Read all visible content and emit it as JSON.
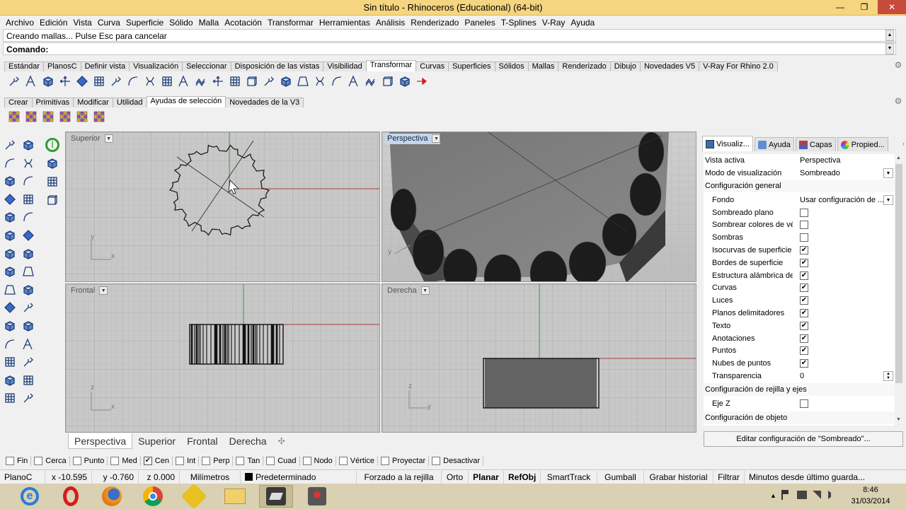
{
  "window": {
    "title": "Sin título - Rhinoceros (Educational) (64-bit)",
    "min": "—",
    "restore": "❐",
    "close": "✕"
  },
  "menu": [
    "Archivo",
    "Edición",
    "Vista",
    "Curva",
    "Superficie",
    "Sólido",
    "Malla",
    "Acotación",
    "Transformar",
    "Herramientas",
    "Análisis",
    "Renderizado",
    "Paneles",
    "T-Splines",
    "V-Ray",
    "Ayuda"
  ],
  "command": {
    "history": "Creando mallas... Pulse Esc para cancelar",
    "prompt": "Comando:"
  },
  "toolbar_tabs": [
    "Estándar",
    "PlanosC",
    "Definir vista",
    "Visualización",
    "Seleccionar",
    "Disposición de las vistas",
    "Visibilidad",
    "Transformar",
    "Curvas",
    "Superficies",
    "Sólidos",
    "Mallas",
    "Renderizado",
    "Dibujo",
    "Novedades V5",
    "V-Ray For Rhino 2.0"
  ],
  "toolbar_tabs_active": "Transformar",
  "sub_tabs": [
    "Crear",
    "Primitivas",
    "Modificar",
    "Utilidad",
    "Ayudas de selección",
    "Novedades de la V3"
  ],
  "sub_tabs_active": "Ayudas de selección",
  "viewports": {
    "top_left": {
      "label": "Superior",
      "axis_x": "x",
      "axis_y": "y"
    },
    "top_right": {
      "label": "Perspectiva",
      "axis_y": "y"
    },
    "bottom_left": {
      "label": "Frontal",
      "axis_x": "x",
      "axis_y": "z"
    },
    "bottom_right": {
      "label": "Derecha",
      "axis_x": "y",
      "axis_y": "z"
    }
  },
  "viewport_tabs": [
    "Perspectiva",
    "Superior",
    "Frontal",
    "Derecha"
  ],
  "viewport_tabs_active": "Perspectiva",
  "viewport_tab_add": "✣",
  "panel": {
    "tabs": [
      {
        "label": "Visualiz...",
        "icon": "monitor-icon"
      },
      {
        "label": "Ayuda",
        "icon": "help-icon"
      },
      {
        "label": "Capas",
        "icon": "layers-icon"
      },
      {
        "label": "Propied...",
        "icon": "properties-icon"
      }
    ],
    "active_view_label": "Vista activa",
    "active_view_value": "Perspectiva",
    "display_mode_label": "Modo de visualización",
    "display_mode_value": "Sombreado",
    "section_general": "Configuración general",
    "background_label": "Fondo",
    "background_value": "Usar configuración de ...",
    "checkboxes": [
      {
        "label": "Sombreado plano",
        "checked": false
      },
      {
        "label": "Sombrear colores de vért...",
        "checked": false
      },
      {
        "label": "Sombras",
        "checked": false
      },
      {
        "label": "Isocurvas de superficie",
        "checked": true
      },
      {
        "label": "Bordes de superficie",
        "checked": true
      },
      {
        "label": "Estructura alámbrica de ...",
        "checked": true
      },
      {
        "label": "Curvas",
        "checked": true
      },
      {
        "label": "Luces",
        "checked": true
      },
      {
        "label": "Planos delimitadores",
        "checked": true
      },
      {
        "label": "Texto",
        "checked": true
      },
      {
        "label": "Anotaciones",
        "checked": true
      },
      {
        "label": "Puntos",
        "checked": true
      },
      {
        "label": "Nubes de puntos",
        "checked": true
      }
    ],
    "transparency_label": "Transparencia",
    "transparency_value": "0",
    "section_grid": "Configuración de rejilla y ejes",
    "zaxis_label": "Eje Z",
    "section_object": "Configuración de objeto",
    "edit_button": "Editar configuración de \"Sombreado\"..."
  },
  "osnaps": [
    {
      "label": "Fin",
      "checked": false
    },
    {
      "label": "Cerca",
      "checked": false
    },
    {
      "label": "Punto",
      "checked": false
    },
    {
      "label": "Med",
      "checked": false
    },
    {
      "label": "Cen",
      "checked": true
    },
    {
      "label": "Int",
      "checked": false
    },
    {
      "label": "Perp",
      "checked": false
    },
    {
      "label": "Tan",
      "checked": false
    },
    {
      "label": "Cuad",
      "checked": false
    },
    {
      "label": "Nodo",
      "checked": false
    },
    {
      "label": "Vértice",
      "checked": false
    },
    {
      "label": "Proyectar",
      "checked": false
    },
    {
      "label": "Desactivar",
      "checked": false
    }
  ],
  "status": {
    "cplane": "PlanoC",
    "x": "x -10.595",
    "y": "y -0.760",
    "z": "z 0.000",
    "units": "Milímetros",
    "layer": "Predeterminado",
    "grid_snap": "Forzado a la rejilla",
    "ortho": "Orto",
    "planar": "Planar",
    "osnap": "RefObj",
    "smarttrack": "SmartTrack",
    "gumball": "Gumball",
    "history": "Grabar historial",
    "filter": "Filtrar",
    "minutes": "Minutos desde último guarda..."
  },
  "taskbar": {
    "time": "8:46",
    "date": "31/03/2014",
    "tray_arrow": "▲",
    "apps": [
      "ie-icon",
      "opera-icon",
      "firefox-icon",
      "chrome-icon",
      "app-icon",
      "explorer-icon",
      "rhino-icon",
      "app2-icon"
    ]
  },
  "colors": {
    "x_axis": "#a04040",
    "y_axis": "#3c9a3c",
    "viewport_bg": "#c7c7c7",
    "grid": "#b3b3b3",
    "active_label": "#c2d7ee"
  }
}
